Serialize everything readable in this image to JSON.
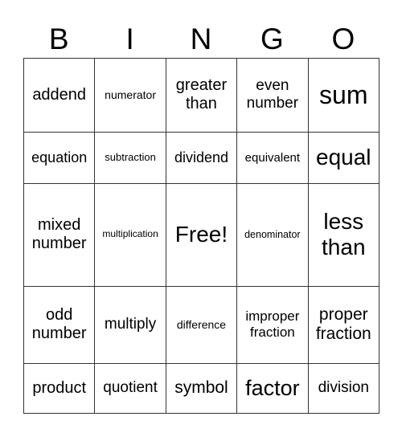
{
  "header": [
    "B",
    "I",
    "N",
    "G",
    "O"
  ],
  "rows": [
    [
      {
        "text": "addend",
        "size": 20
      },
      {
        "text": "numerator",
        "size": 14
      },
      {
        "text": "greater than",
        "size": 20
      },
      {
        "text": "even number",
        "size": 19
      },
      {
        "text": "sum",
        "size": 32
      }
    ],
    [
      {
        "text": "equation",
        "size": 18
      },
      {
        "text": "subtraction",
        "size": 13
      },
      {
        "text": "dividend",
        "size": 18
      },
      {
        "text": "equivalent",
        "size": 15
      },
      {
        "text": "equal",
        "size": 28
      }
    ],
    [
      {
        "text": "mixed number",
        "size": 20
      },
      {
        "text": "multiplication",
        "size": 12
      },
      {
        "text": "Free!",
        "size": 28
      },
      {
        "text": "denominator",
        "size": 12.5
      },
      {
        "text": "less than",
        "size": 28
      }
    ],
    [
      {
        "text": "odd number",
        "size": 20
      },
      {
        "text": "multiply",
        "size": 19
      },
      {
        "text": "difference",
        "size": 14
      },
      {
        "text": "improper fraction",
        "size": 17
      },
      {
        "text": "proper fraction",
        "size": 21
      }
    ],
    [
      {
        "text": "product",
        "size": 20
      },
      {
        "text": "quotient",
        "size": 19
      },
      {
        "text": "symbol",
        "size": 21
      },
      {
        "text": "factor",
        "size": 27
      },
      {
        "text": "division",
        "size": 19
      }
    ]
  ]
}
